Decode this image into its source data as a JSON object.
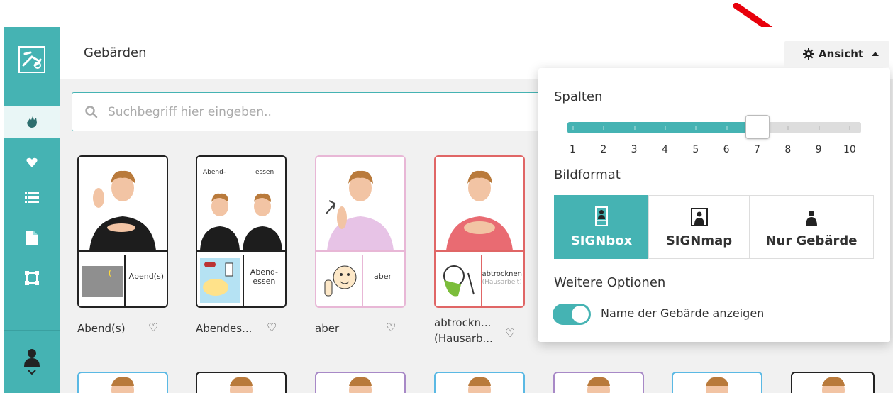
{
  "header": {
    "title": "Gebärden"
  },
  "view_button": {
    "label": "Ansicht",
    "icon": "gear-icon",
    "caret": "caret-up-icon"
  },
  "search": {
    "placeholder": "Suchbegriff hier eingeben.."
  },
  "sidebar": {
    "items": [
      {
        "name": "signs",
        "icon": "hand-icon",
        "active": true
      },
      {
        "name": "favorites",
        "icon": "heart-icon"
      },
      {
        "name": "lists",
        "icon": "list-icon"
      },
      {
        "name": "documents",
        "icon": "file-icon"
      },
      {
        "name": "frames",
        "icon": "frame-icon"
      }
    ],
    "user": {
      "icon": "user-icon",
      "caret": "chevron-down-icon"
    }
  },
  "cards": [
    {
      "label": "Abend(s)",
      "symbol_word": "Abend(s)",
      "border": "#222222",
      "shirt": "#1d1d1d"
    },
    {
      "label": "Abendes...",
      "symbol_word": "Abend-\nessen",
      "top_text_1": "Abend-",
      "top_text_2": "essen",
      "border": "#222222",
      "shirt": "#1d1d1d"
    },
    {
      "label": "aber",
      "symbol_word": "aber",
      "border": "#e8b7d6",
      "shirt": "#e7c3e6"
    },
    {
      "label_1": "abtrockn...",
      "label_2": "(Hausarb...",
      "symbol_word": "abtrocknen",
      "symbol_sub": "(Hausarbeit)",
      "border": "#e06666",
      "shirt": "#e96b72"
    }
  ],
  "second_row_borders": [
    "#5bb9e4",
    "#222222",
    "#a889c7",
    "#5bb9e4",
    "#a889c7",
    "#5bb9e4",
    "#222222"
  ],
  "panel": {
    "columns_heading": "Spalten",
    "columns_value": 7,
    "columns_min": 1,
    "columns_max": 10,
    "column_numbers": [
      "1",
      "2",
      "3",
      "4",
      "5",
      "6",
      "7",
      "8",
      "9",
      "10"
    ],
    "format_heading": "Bildformat",
    "formats": [
      {
        "label": "SIGNbox",
        "active": true,
        "icon": "signbox-icon"
      },
      {
        "label": "SIGNmap",
        "active": false,
        "icon": "signmap-icon"
      },
      {
        "label": "Nur Gebärde",
        "active": false,
        "icon": "sign-only-icon"
      }
    ],
    "more_heading": "Weitere Optionen",
    "toggle_label": "Name der Gebärde anzeigen",
    "toggle_on": true
  },
  "colors": {
    "accent": "#45b3b3",
    "annotation_arrow": "#e8000b"
  }
}
